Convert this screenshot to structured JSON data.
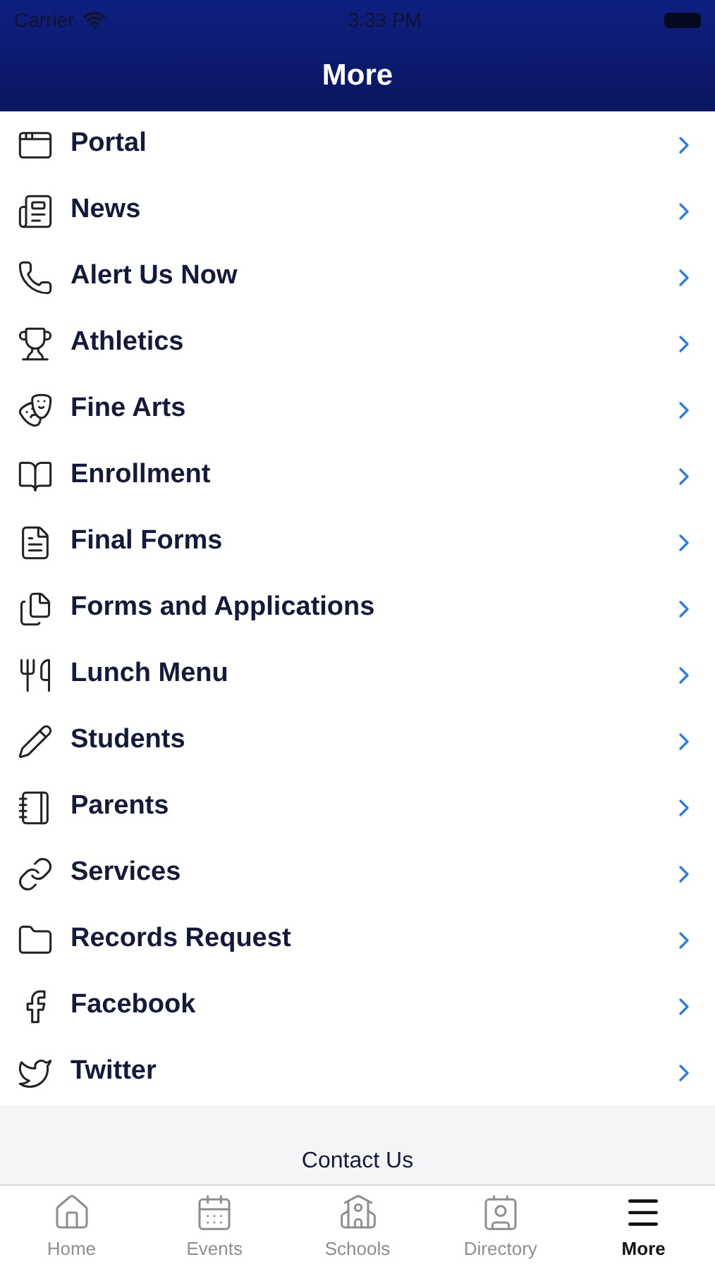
{
  "status_bar": {
    "carrier": "Carrier",
    "time": "3:33 PM"
  },
  "nav_bar": {
    "title": "More"
  },
  "menu_items": [
    {
      "label": "Portal"
    },
    {
      "label": "News"
    },
    {
      "label": "Alert Us Now"
    },
    {
      "label": "Athletics"
    },
    {
      "label": "Fine Arts"
    },
    {
      "label": "Enrollment"
    },
    {
      "label": "Final Forms"
    },
    {
      "label": "Forms and Applications"
    },
    {
      "label": "Lunch Menu"
    },
    {
      "label": "Students"
    },
    {
      "label": "Parents"
    },
    {
      "label": "Services"
    },
    {
      "label": "Records Request"
    },
    {
      "label": "Facebook"
    },
    {
      "label": "Twitter"
    }
  ],
  "section_header": "Contact Us",
  "tab_bar": [
    {
      "label": "Home",
      "selected": false
    },
    {
      "label": "Events",
      "selected": false
    },
    {
      "label": "Schools",
      "selected": false
    },
    {
      "label": "Directory",
      "selected": false
    },
    {
      "label": "More",
      "selected": true
    }
  ]
}
